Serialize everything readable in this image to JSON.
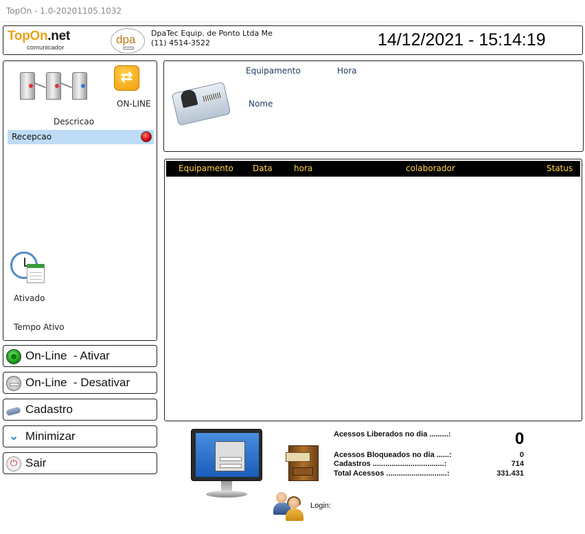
{
  "window": {
    "title": "TopOn - 1.0-20201105.1032"
  },
  "header": {
    "logo_main": "TopOn",
    "logo_suffix": ".net",
    "logo_sub": "comunicador",
    "partner_logo": "dpa",
    "company_name": "DpaTec Equip. de Ponto Ltda Me",
    "company_phone": "(11) 4514-3522",
    "datetime": "14/12/2021 - 15:14:19"
  },
  "left_panel": {
    "online_label": "ON-LINE",
    "descricao_label": "Descricao",
    "devices": [
      {
        "name": "Recepcao",
        "status_color": "#d40000"
      }
    ],
    "ativado_label": "Ativado",
    "tempo_ativo_label": "Tempo Ativo"
  },
  "buttons": {
    "online_ativar": "On-Line  - Ativar",
    "online_desativar": "On-Line  - Desativar",
    "cadastro": "Cadastro",
    "minimizar": "Minimizar",
    "sair": "Sair"
  },
  "access_info": {
    "equipamento_label": "Equipamento",
    "hora_label": "Hora",
    "nome_label": "Nome"
  },
  "log_table": {
    "columns": [
      "Equipamento",
      "Data",
      "hora",
      "colaborador",
      "Status"
    ],
    "rows": []
  },
  "stats": {
    "liberados_label": "Acessos Liberados no dia .........:",
    "liberados_value": "0",
    "bloqueados_label": "Acessos Bloqueados no dia ......:",
    "bloqueados_value": "0",
    "cadastros_label": "Cadastros ..................................:",
    "cadastros_value": "714",
    "total_label": "Total Acessos .............................:",
    "total_value": "331.431"
  },
  "login": {
    "label": "Login:"
  },
  "icons": {
    "turnstile": "turnstile-icon",
    "online": "swap-arrows-icon",
    "clock": "clock-calendar-icon",
    "badge": "id-badge-icon",
    "monitor": "login-monitor-icon",
    "cabinet": "file-cabinet-icon",
    "users": "users-icon"
  },
  "colors": {
    "accent": "#e8a21a",
    "header_text": "#ffd54a",
    "selection": "#bfdcf7"
  }
}
